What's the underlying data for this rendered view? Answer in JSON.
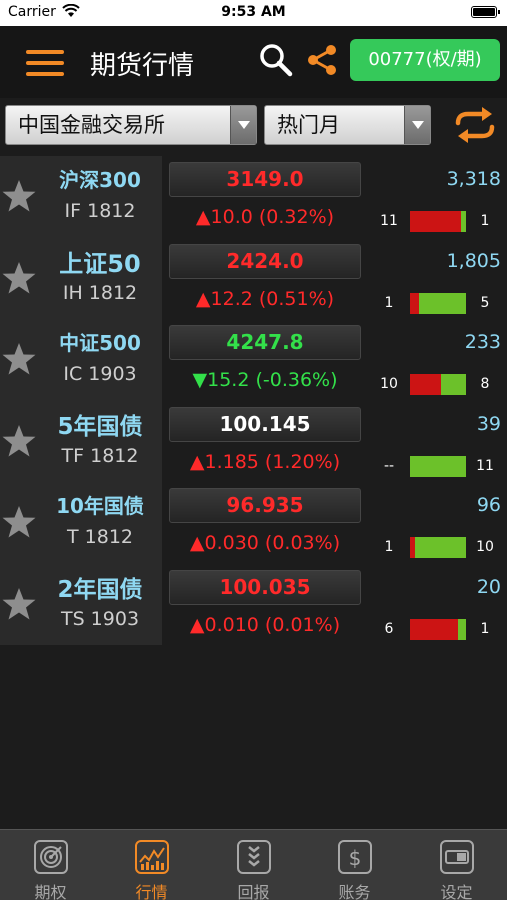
{
  "status_bar": {
    "carrier": "Carrier",
    "time": "9:53 AM"
  },
  "nav": {
    "title": "期货行情",
    "account_label": "00777(权/期)",
    "accent_color": "#f28a26",
    "account_color": "#35c95a"
  },
  "filters": {
    "exchange": "中国金融交易所",
    "month": "热门月"
  },
  "rows": [
    {
      "name": "沪深300",
      "code": "IF 1812",
      "price": "3149.0",
      "price_dir": "red",
      "change": "▲10.0 (0.32%)",
      "change_dir": "red",
      "volume": "3,318",
      "bid_qty": "11",
      "ask_qty": "1",
      "bid_fraction": 0.917
    },
    {
      "name": "上证50",
      "code": "IH 1812",
      "price": "2424.0",
      "price_dir": "red",
      "change": "▲12.2 (0.51%)",
      "change_dir": "red",
      "volume": "1,805",
      "bid_qty": "1",
      "ask_qty": "5",
      "bid_fraction": 0.167
    },
    {
      "name": "中证500",
      "code": "IC 1903",
      "price": "4247.8",
      "price_dir": "green",
      "change": "▼15.2 (-0.36%)",
      "change_dir": "green",
      "volume": "233",
      "bid_qty": "10",
      "ask_qty": "8",
      "bid_fraction": 0.556
    },
    {
      "name": "5年国债",
      "code": "TF 1812",
      "price": "100.145",
      "price_dir": "white",
      "change": "▲1.185 (1.20%)",
      "change_dir": "red",
      "volume": "39",
      "bid_qty": "--",
      "ask_qty": "11",
      "bid_fraction": 0
    },
    {
      "name": "10年国债",
      "code": "T 1812",
      "price": "96.935",
      "price_dir": "red",
      "change": "▲0.030 (0.03%)",
      "change_dir": "red",
      "volume": "96",
      "bid_qty": "1",
      "ask_qty": "10",
      "bid_fraction": 0.091
    },
    {
      "name": "2年国债",
      "code": "TS 1903",
      "price": "100.035",
      "price_dir": "red",
      "change": "▲0.010 (0.01%)",
      "change_dir": "red",
      "volume": "20",
      "bid_qty": "6",
      "ask_qty": "1",
      "bid_fraction": 0.857
    }
  ],
  "tabs": [
    {
      "label": "期权",
      "icon": "target-icon",
      "active": false
    },
    {
      "label": "行情",
      "icon": "chart-icon",
      "active": true
    },
    {
      "label": "回报",
      "icon": "report-icon",
      "active": false
    },
    {
      "label": "账务",
      "icon": "dollar-icon",
      "active": false
    },
    {
      "label": "设定",
      "icon": "settings-icon",
      "active": false
    }
  ]
}
